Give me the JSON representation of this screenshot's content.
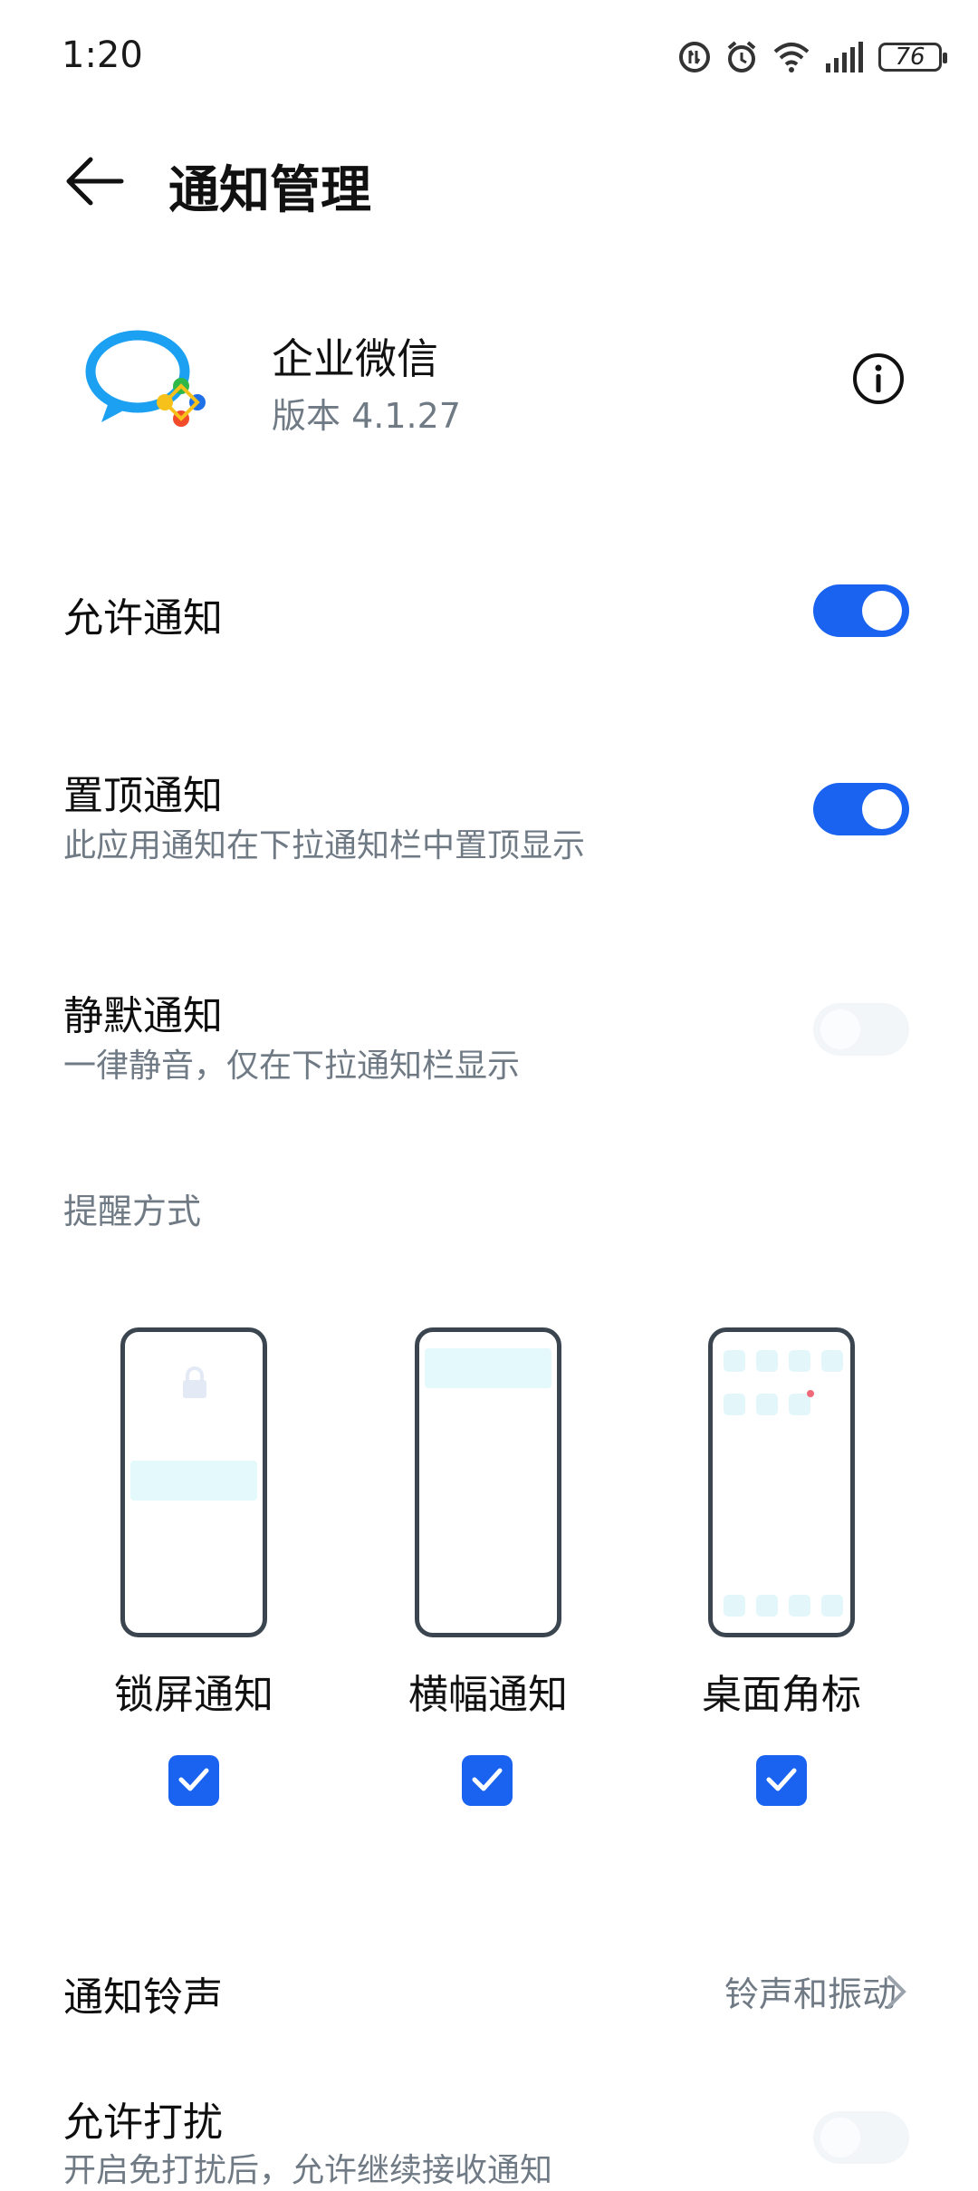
{
  "status_bar": {
    "time": "1:20",
    "battery": "76"
  },
  "header": {
    "title": "通知管理"
  },
  "app": {
    "name": "企业微信",
    "version": "版本 4.1.27"
  },
  "rows": {
    "allow": {
      "title": "允许通知",
      "enabled": true
    },
    "pin": {
      "title": "置顶通知",
      "subtitle": "此应用通知在下拉通知栏中置顶显示",
      "enabled": true
    },
    "silent": {
      "title": "静默通知",
      "subtitle": "一律静音，仅在下拉通知栏显示",
      "enabled": false
    }
  },
  "reminder": {
    "label": "提醒方式",
    "options": [
      {
        "label": "锁屏通知",
        "checked": true
      },
      {
        "label": "横幅通知",
        "checked": true
      },
      {
        "label": "桌面角标",
        "checked": true
      }
    ]
  },
  "ringtone": {
    "title": "通知铃声",
    "value": "铃声和振动"
  },
  "dnd": {
    "title": "允许打扰",
    "subtitle": "开启免打扰后，允许继续接收通知",
    "enabled": false
  },
  "colors": {
    "accent": "#1a63f0",
    "secondary_text": "#6f7a85"
  }
}
